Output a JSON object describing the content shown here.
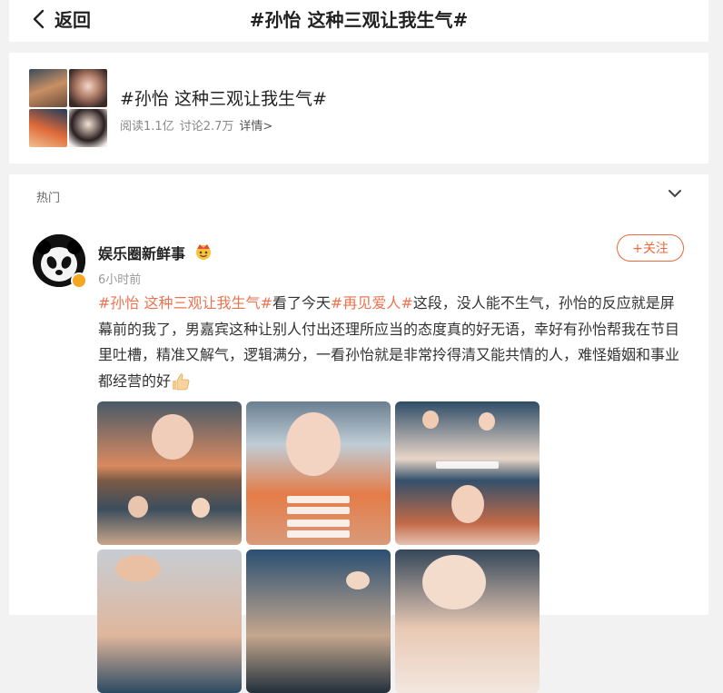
{
  "header": {
    "back_label": "返回",
    "title": "#孙怡 这种三观让我生气#"
  },
  "topic": {
    "title": "#孙怡 这种三观让我生气#",
    "reads": "阅读1.1亿",
    "discussions": "讨论2.7万",
    "details_link": "详情>"
  },
  "feed": {
    "tab_label": "热门",
    "post": {
      "author": "娱乐圈新鲜事",
      "time": "6小时前",
      "follow_label": "+关注",
      "tag1": "#孙怡 这种三观让我生气#",
      "text1": "看了今天",
      "tag2": "#再见爱人#",
      "text2": "这段，没人能不生气，孙怡的反应就是屏幕前的我了，男嘉宾这种让别人付出还理所应当的态度真的好无语，幸好有孙怡帮我在节目里吐槽，精准又解气，逻辑满分，一看孙怡就是非常拎得清又能共情的人，难怪婚姻和事业都经营的好",
      "image_count": 6
    }
  },
  "colors": {
    "accent": "#eb7350",
    "follow": "#e96a3c",
    "verified": "#f5a623"
  },
  "icons": [
    "back-chevron-icon",
    "chevron-down-icon",
    "crown-emoji-icon",
    "thumbs-up-icon",
    "verified-badge-icon"
  ]
}
